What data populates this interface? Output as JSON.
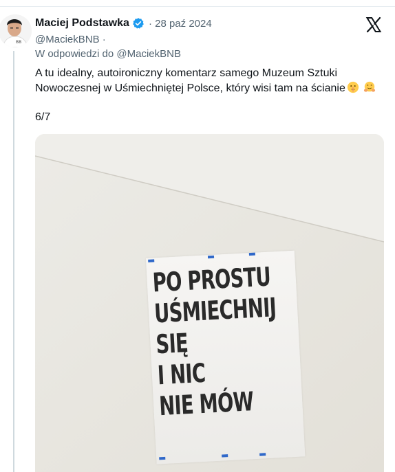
{
  "tweet": {
    "author_name": "Maciej Podstawka",
    "date": "· 28 paź 2024",
    "handle": "@MaciekBNB ·",
    "reply_prefix": "W odpowiedzi do",
    "reply_to": "@MaciekBNB",
    "text_line1": "A tu idealny, autoironiczny komentarz samego Muzeum Sztuki",
    "text_line2": "Nowoczesnej w Uśmiechniętej Polsce, który wisi tam na ścianie",
    "thread_count": "6/7",
    "emojis": [
      "shushing-face-emoji",
      "hugging-face-emoji"
    ]
  },
  "photo": {
    "poster_lines": [
      "PO PROSTU",
      "UŚMIECHNIJ",
      "SIĘ",
      "I NIC",
      "NIE MÓW"
    ]
  },
  "colors": {
    "verified": "#1d9bf0",
    "muted_text": "#536471",
    "text": "#0f1419",
    "wall": "#e9e6df",
    "tape": "#2f68c9"
  }
}
